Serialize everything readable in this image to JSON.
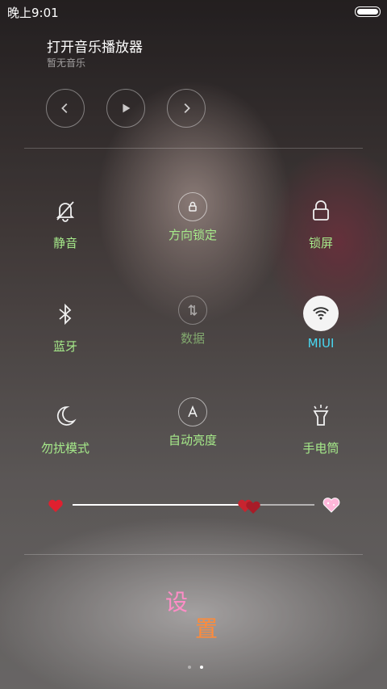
{
  "status_bar": {
    "time": "晚上9:01"
  },
  "music": {
    "title": "打开音乐播放器",
    "subtitle": "暂无音乐",
    "controls": [
      "previous-icon",
      "play-icon",
      "next-icon"
    ]
  },
  "toggles": [
    {
      "id": "mute",
      "label": "静音",
      "icon": "bell-off-icon",
      "active": false,
      "label_color": "#a6ea8a"
    },
    {
      "id": "rotation_lock",
      "label": "方向锁定",
      "icon": "rotation-lock-icon",
      "active": false,
      "label_color": "#a6ea8a"
    },
    {
      "id": "lock_screen",
      "label": "锁屏",
      "icon": "lock-icon",
      "active": false,
      "label_color": "#a6ea8a"
    },
    {
      "id": "bluetooth",
      "label": "蓝牙",
      "icon": "bluetooth-icon",
      "active": false,
      "label_color": "#a6ea8a"
    },
    {
      "id": "data",
      "label": "数据",
      "icon": "data-icon",
      "active": false,
      "label_color": "#a6ea8a"
    },
    {
      "id": "wifi",
      "label": "MIUI",
      "icon": "wifi-icon",
      "active": true,
      "label_color": "#48d8f2"
    },
    {
      "id": "dnd",
      "label": "勿扰模式",
      "icon": "moon-icon",
      "active": false,
      "label_color": "#a6ea8a"
    },
    {
      "id": "auto_brightness",
      "label": "自动亮度",
      "icon": "auto-brightness-icon",
      "active": false,
      "label_color": "#a6ea8a"
    },
    {
      "id": "flashlight",
      "label": "手电筒",
      "icon": "flashlight-icon",
      "active": false,
      "label_color": "#a6ea8a"
    }
  ],
  "brightness": {
    "level": 0.73,
    "min_icon": "heart-icon",
    "max_icon": "sparkle-heart-icon"
  },
  "settings": {
    "char1": "设",
    "char2": "置"
  },
  "colors": {
    "label_green": "#a6ea8a",
    "active_blue": "#48d8f2",
    "heart_red": "#e0202f"
  },
  "pager": {
    "pages": 2,
    "current": 2
  }
}
